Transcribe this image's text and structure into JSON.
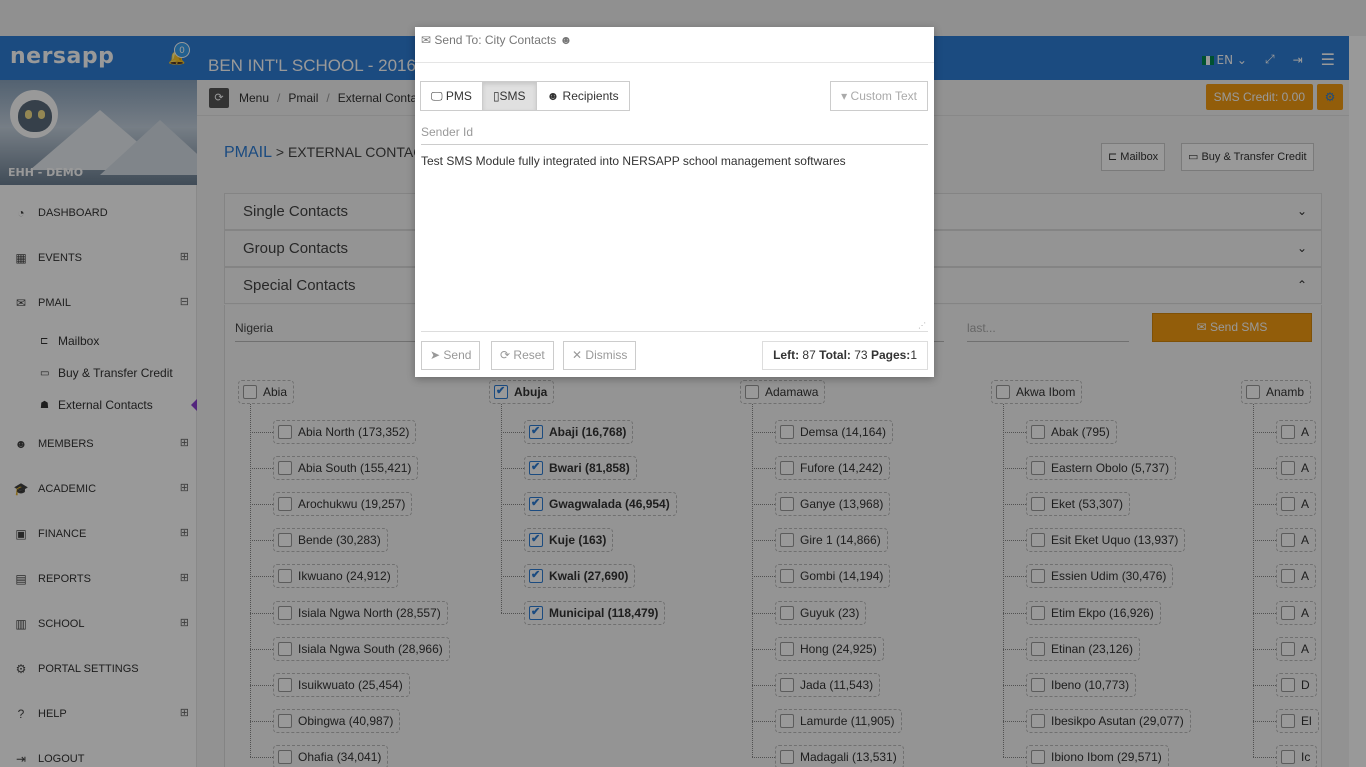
{
  "header": {
    "logo": "nersapp",
    "notif_count": "0",
    "school_title": "BEN INT'L SCHOOL - 2016",
    "lang": "EN"
  },
  "profile": {
    "name": "EHH - DEMO"
  },
  "sidebar": {
    "items": [
      {
        "label": "DASHBOARD"
      },
      {
        "label": "EVENTS"
      },
      {
        "label": "PMAIL"
      },
      {
        "label": "MEMBERS"
      },
      {
        "label": "ACADEMIC"
      },
      {
        "label": "FINANCE"
      },
      {
        "label": "REPORTS"
      },
      {
        "label": "SCHOOL"
      },
      {
        "label": "PORTAL SETTINGS"
      },
      {
        "label": "HELP"
      },
      {
        "label": "LOGOUT"
      }
    ],
    "pmail_sub": [
      {
        "label": "Mailbox"
      },
      {
        "label": "Buy & Transfer Credit"
      },
      {
        "label": "External Contacts"
      }
    ]
  },
  "breadcrumb": {
    "items": [
      "Menu",
      "Pmail",
      "External Conta"
    ]
  },
  "sms_credit": "SMS Credit: 0.00",
  "page": {
    "title_main": "PMAIL",
    "title_rest": " > EXTERNAL CONTACT",
    "mailbox_btn": "Mailbox",
    "buy_btn": "Buy & Transfer Credit"
  },
  "panels": {
    "single": "Single Contacts",
    "group": "Group Contacts",
    "special": "Special Contacts"
  },
  "filters": {
    "country": "Nigeria",
    "last_placeholder": "last...",
    "send_sms": "Send SMS"
  },
  "states": [
    {
      "name": "Abia",
      "checked": false,
      "lgas": [
        {
          "n": "Abia North (173,352)",
          "c": false
        },
        {
          "n": "Abia South (155,421)",
          "c": false
        },
        {
          "n": "Arochukwu (19,257)",
          "c": false
        },
        {
          "n": "Bende (30,283)",
          "c": false
        },
        {
          "n": "Ikwuano (24,912)",
          "c": false
        },
        {
          "n": "Isiala Ngwa North (28,557)",
          "c": false
        },
        {
          "n": "Isiala Ngwa South (28,966)",
          "c": false
        },
        {
          "n": "Isuikwuato (25,454)",
          "c": false
        },
        {
          "n": "Obingwa (40,987)",
          "c": false
        },
        {
          "n": "Ohafia (34,041)",
          "c": false
        }
      ]
    },
    {
      "name": "Abuja",
      "checked": true,
      "lgas": [
        {
          "n": "Abaji (16,768)",
          "c": true
        },
        {
          "n": "Bwari (81,858)",
          "c": true
        },
        {
          "n": "Gwagwalada (46,954)",
          "c": true
        },
        {
          "n": "Kuje (163)",
          "c": true
        },
        {
          "n": "Kwali (27,690)",
          "c": true
        },
        {
          "n": "Municipal (118,479)",
          "c": true
        }
      ]
    },
    {
      "name": "Adamawa",
      "checked": false,
      "lgas": [
        {
          "n": "Demsa (14,164)",
          "c": false
        },
        {
          "n": "Fufore (14,242)",
          "c": false
        },
        {
          "n": "Ganye (13,968)",
          "c": false
        },
        {
          "n": "Gire 1 (14,866)",
          "c": false
        },
        {
          "n": "Gombi (14,194)",
          "c": false
        },
        {
          "n": "Guyuk (23)",
          "c": false
        },
        {
          "n": "Hong (24,925)",
          "c": false
        },
        {
          "n": "Jada (11,543)",
          "c": false
        },
        {
          "n": "Lamurde (11,905)",
          "c": false
        },
        {
          "n": "Madagali (13,531)",
          "c": false
        }
      ]
    },
    {
      "name": "Akwa Ibom",
      "checked": false,
      "lgas": [
        {
          "n": "Abak (795)",
          "c": false
        },
        {
          "n": "Eastern Obolo (5,737)",
          "c": false
        },
        {
          "n": "Eket (53,307)",
          "c": false
        },
        {
          "n": "Esit Eket Uquo (13,937)",
          "c": false
        },
        {
          "n": "Essien Udim (30,476)",
          "c": false
        },
        {
          "n": "Etim Ekpo (16,926)",
          "c": false
        },
        {
          "n": "Etinan (23,126)",
          "c": false
        },
        {
          "n": "Ibeno (10,773)",
          "c": false
        },
        {
          "n": "Ibesikpo Asutan (29,077)",
          "c": false
        },
        {
          "n": "Ibiono Ibom (29,571)",
          "c": false
        }
      ]
    },
    {
      "name": "Anamb",
      "checked": false,
      "lgas": [
        {
          "n": "A",
          "c": false
        },
        {
          "n": "A",
          "c": false
        },
        {
          "n": "A",
          "c": false
        },
        {
          "n": "A",
          "c": false
        },
        {
          "n": "A",
          "c": false
        },
        {
          "n": "A",
          "c": false
        },
        {
          "n": "A",
          "c": false
        },
        {
          "n": "D",
          "c": false
        },
        {
          "n": "El",
          "c": false
        },
        {
          "n": "Ic",
          "c": false
        }
      ]
    }
  ],
  "modal": {
    "title": "Send To: City Contacts",
    "tabs": [
      "PMS",
      "SMS",
      "Recipients"
    ],
    "custom_text": "Custom Text",
    "sender_placeholder": "Sender Id",
    "message": "Test SMS Module fully integrated into NERSAPP school management softwares",
    "send": "Send",
    "reset": "Reset",
    "dismiss": "Dismiss",
    "left_label": "Left:",
    "left": "87",
    "total_label": "Total:",
    "total": "73",
    "pages_label": "Pages:",
    "pages": "1"
  }
}
